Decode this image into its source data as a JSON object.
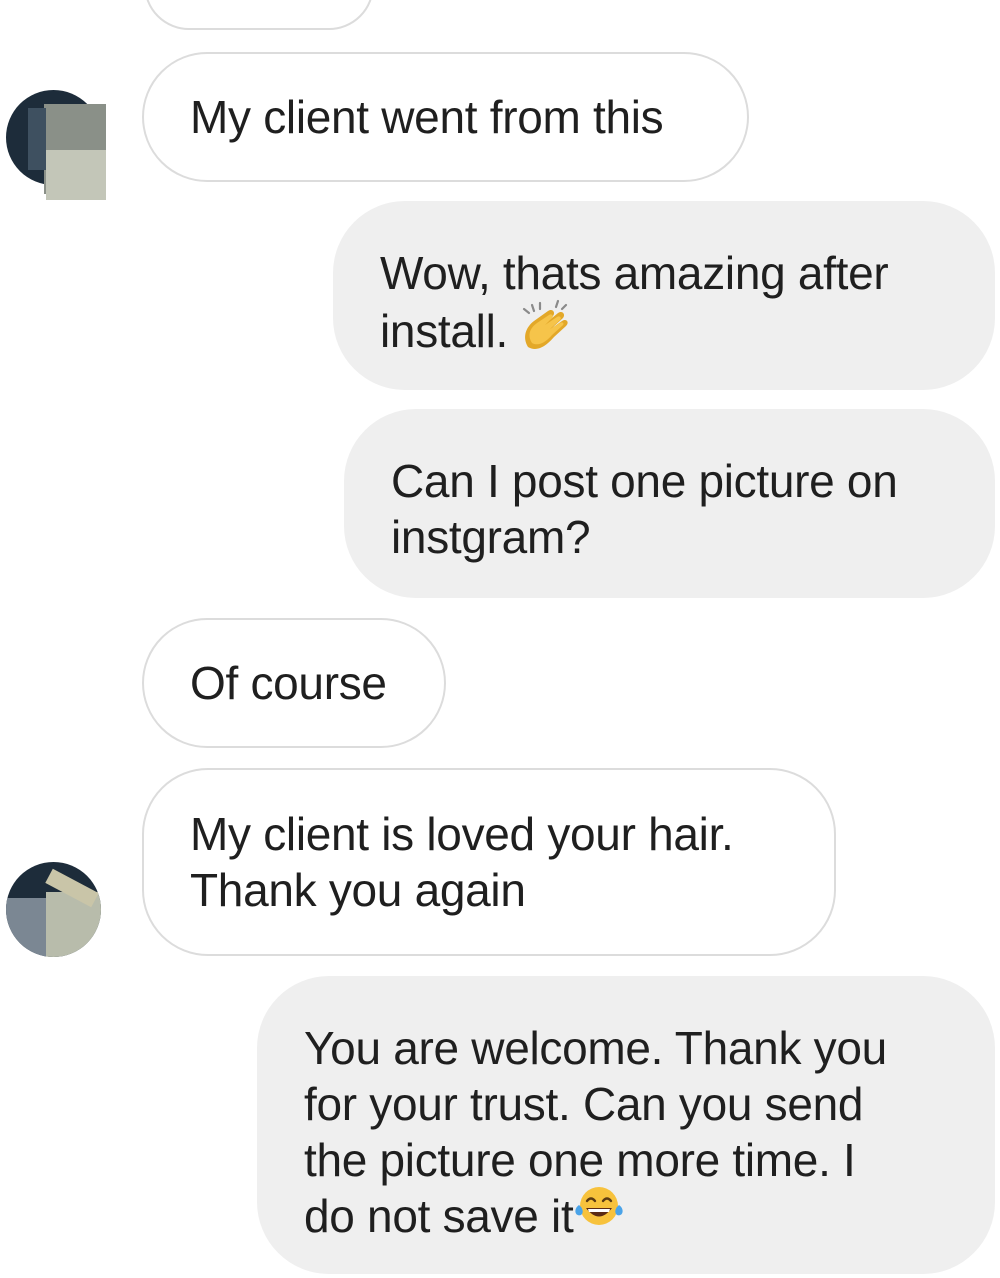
{
  "colors": {
    "incoming_bubble_bg": "#ffffff",
    "incoming_bubble_border": "#dcdcdc",
    "outgoing_bubble_bg": "#efefef",
    "text": "#1f1f1f"
  },
  "messages": [
    {
      "id": "m0",
      "direction": "incoming",
      "text": ""
    },
    {
      "id": "m1",
      "direction": "incoming",
      "text": "My client went from this"
    },
    {
      "id": "m2",
      "direction": "outgoing",
      "text": "Wow, thats amazing after\ninstall.",
      "emoji": "clapping-hands-emoji"
    },
    {
      "id": "m3",
      "direction": "outgoing",
      "text": "Can I post one picture on\ninstgram?"
    },
    {
      "id": "m4",
      "direction": "incoming",
      "text": "Of course"
    },
    {
      "id": "m5",
      "direction": "incoming",
      "text": "My client is loved your hair.\nThank you again"
    },
    {
      "id": "m6",
      "direction": "outgoing",
      "text": "You are welcome. Thank you\nfor your trust. Can you send\nthe picture one more time. I\ndo not save it",
      "emoji": "tears-of-joy-emoji"
    }
  ],
  "avatars": [
    {
      "id": "avatar-1",
      "icon": "contact-avatar"
    },
    {
      "id": "avatar-2",
      "icon": "contact-avatar"
    }
  ]
}
